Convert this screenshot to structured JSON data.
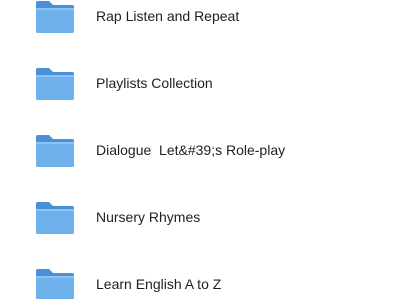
{
  "colors": {
    "folder_back": "#4a90d9",
    "folder_front": "#6fb1ea",
    "folder_highlight": "#8cc3f1",
    "text": "#1f1f1f",
    "background": "#ffffff"
  },
  "folders": [
    {
      "name": "Rap Listen and Repeat",
      "icon": "folder-icon"
    },
    {
      "name": "Playlists Collection",
      "icon": "folder-icon"
    },
    {
      "name": "Dialogue  Let&#39;s Role-play",
      "icon": "folder-icon"
    },
    {
      "name": "Nursery Rhymes",
      "icon": "folder-icon"
    },
    {
      "name": "Learn English A to Z",
      "icon": "folder-icon"
    }
  ]
}
